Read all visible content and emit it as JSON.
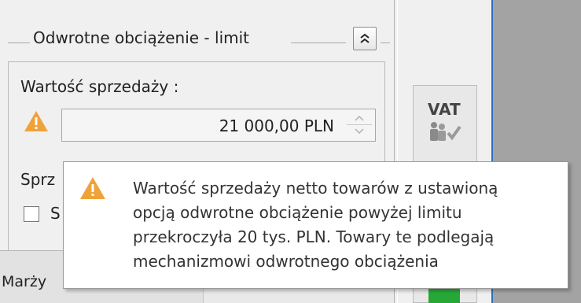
{
  "group": {
    "title": "Odwrotne obciążenie - limit",
    "collapse_icon": "double-chevron-up-icon"
  },
  "sales": {
    "label": "Wartość sprzedaży :",
    "value": "21 000,00 PLN",
    "warning_icon": "warning-triangle-icon"
  },
  "partial_labels": {
    "sprz": "Sprz",
    "checkbox_letter": "S",
    "marzy": "Marży"
  },
  "vat_button": {
    "label": "VAT",
    "icon": "vat-people-check-icon"
  },
  "tooltip": {
    "icon": "warning-triangle-icon",
    "lines": [
      "Wartość sprzedaży netto towarów z ustawioną",
      "opcją odwrotne obciążenie powyżej limitu",
      "przekroczyła 20 tys. PLN. Towary te podlegają",
      "mechanizmowi odwrotnego obciążenia"
    ]
  },
  "colors": {
    "warning": "#f0a23a",
    "accent_blue": "#2f6fbf",
    "green": "#27a836"
  }
}
